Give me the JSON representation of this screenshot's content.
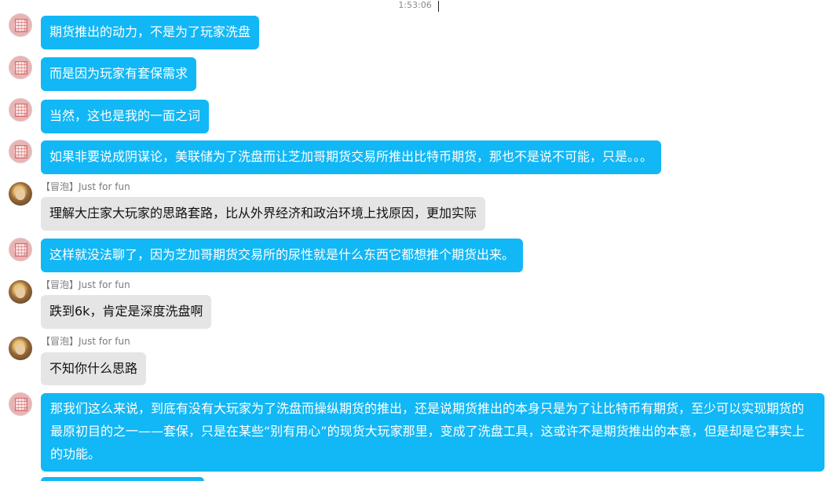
{
  "header": {
    "timestamp": "1:53:06"
  },
  "messages": [
    {
      "from": "self",
      "text": "期货推出的动力，不是为了玩家洗盘"
    },
    {
      "from": "self",
      "text": "而是因为玩家有套保需求"
    },
    {
      "from": "self",
      "text": "当然，这也是我的一面之词"
    },
    {
      "from": "self",
      "text": "如果非要说成阴谋论，美联储为了洗盘而让芝加哥期货交易所推出比特币期货，那也不是说不可能，只是。。。"
    },
    {
      "from": "other",
      "tag": "【冒泡】",
      "sender": "Just for fun",
      "text": "理解大庄家大玩家的思路套路，比从外界经济和政治环境上找原因，更加实际"
    },
    {
      "from": "self",
      "text": "这样就没法聊了，因为芝加哥期货交易所的尿性就是什么东西它都想推个期货出来。"
    },
    {
      "from": "other",
      "tag": "【冒泡】",
      "sender": "Just for fun",
      "text": "跌到6k，肯定是深度洗盘啊"
    },
    {
      "from": "other",
      "tag": "【冒泡】",
      "sender": "Just for fun",
      "text": "不知你什么思路"
    },
    {
      "from": "self",
      "text": "那我们这么来说，到底有没有大玩家为了洗盘而操纵期货的推出，还是说期货推出的本身只是为了让比特币有期货，至少可以实现期货的最原初目的之一——套保，只是在某些“别有用心”的现货大玩家那里，变成了洗盘工具，这或许不是期货推出的本意，但是却是它事实上的功能。"
    }
  ],
  "colors": {
    "self_bubble": "#12b7f5",
    "other_bubble": "#e5e5e5"
  }
}
